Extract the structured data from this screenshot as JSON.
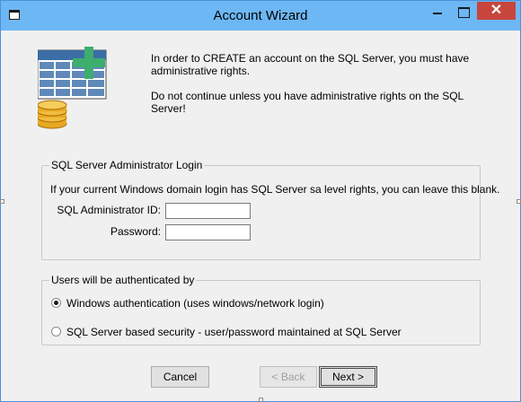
{
  "window": {
    "title": "Account Wizard",
    "close_glyph": "✕",
    "icons": [
      "app-icon",
      "minimize-icon",
      "maximize-icon",
      "close-icon",
      "database-add-icon"
    ]
  },
  "intro": {
    "line1": "In order to CREATE an account on the SQL Server, you must have administrative rights.",
    "line2": "Do not continue unless you have administrative rights on the SQL Server!"
  },
  "login_group": {
    "legend": "SQL Server Administrator Login",
    "info": "If your current Windows domain login has SQL Server sa level rights, you can leave this blank.",
    "admin_id_label": "SQL Administrator ID:",
    "admin_id_value": "",
    "password_label": "Password:",
    "password_value": ""
  },
  "auth_group": {
    "legend": "Users will be authenticated by",
    "option_windows": "Windows authentication (uses windows/network login)",
    "option_sql": "SQL Server based security - user/password maintained at SQL Server",
    "selected": "windows"
  },
  "buttons": {
    "cancel": "Cancel",
    "back": "< Back",
    "next": "Next >"
  },
  "colors": {
    "titlebar": "#6db7f5",
    "close_button": "#c7463b",
    "window_bg": "#f0f0f0",
    "grid_blue": "#3b6ea5",
    "plus_green": "#3dae6d",
    "coin_gold": "#e8a722"
  }
}
